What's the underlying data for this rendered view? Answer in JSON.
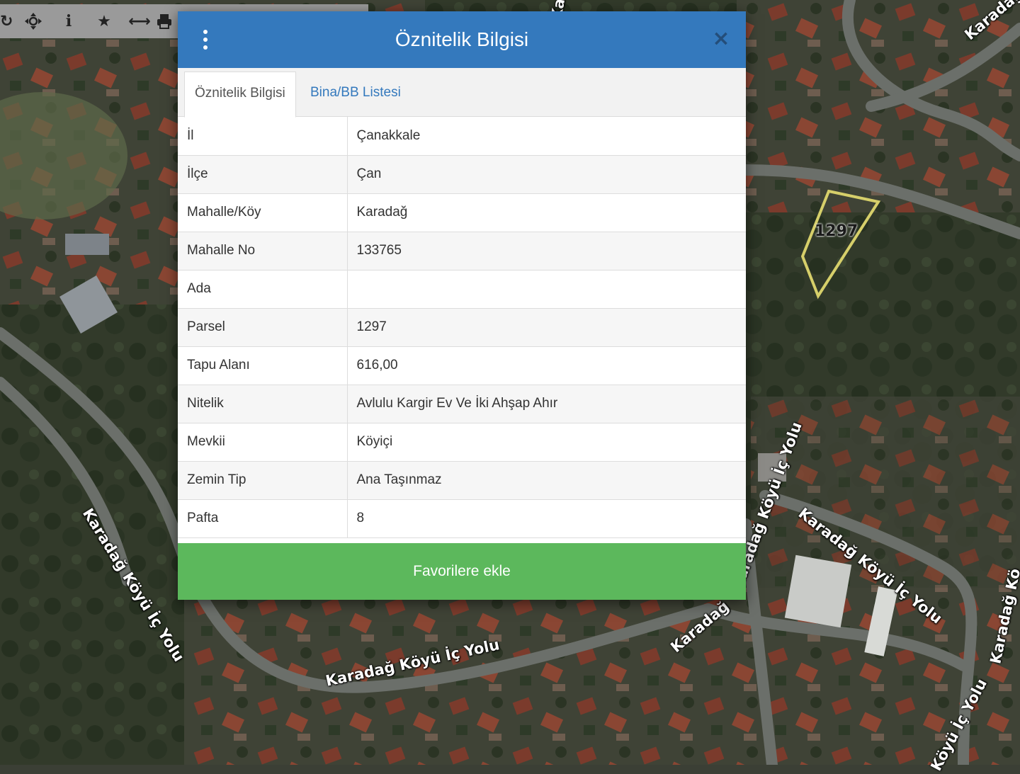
{
  "toolbar": {
    "tools": [
      {
        "icon": "refresh-icon"
      },
      {
        "icon": "pan-move-icon"
      },
      {
        "icon": "info-icon"
      },
      {
        "icon": "star-icon"
      },
      {
        "icon": "measure-distance-icon"
      },
      {
        "icon": "print-icon"
      }
    ]
  },
  "map": {
    "road_labels": [
      "Karadağ Köyü İç Yolu",
      "Karadağ Köyü İç Yolu",
      "Karadağ Köyü İç Yolu",
      "Karadağ",
      "Karadağ Köyü İç Yolu",
      "Köyü İç Yolu",
      "Karadağ Kö",
      "Karadağ",
      "Karad"
    ],
    "parcel_label": "1297",
    "colors": {
      "parcel_outline": "#d6cf6a",
      "road": "#6b6f6a"
    }
  },
  "modal": {
    "title": "Öznitelik Bilgisi",
    "close_symbol": "×",
    "tabs": [
      {
        "label": "Öznitelik Bilgisi",
        "active": true
      },
      {
        "label": "Bina/BB Listesi",
        "active": false
      }
    ],
    "rows": [
      {
        "key": "İl",
        "value": "Çanakkale"
      },
      {
        "key": "İlçe",
        "value": "Çan"
      },
      {
        "key": "Mahalle/Köy",
        "value": "Karadağ"
      },
      {
        "key": "Mahalle No",
        "value": "133765"
      },
      {
        "key": "Ada",
        "value": ""
      },
      {
        "key": "Parsel",
        "value": "1297"
      },
      {
        "key": "Tapu Alanı",
        "value": "616,00"
      },
      {
        "key": "Nitelik",
        "value": "Avlulu Kargir Ev Ve İki Ahşap Ahır"
      },
      {
        "key": "Mevkii",
        "value": "Köyiçi"
      },
      {
        "key": "Zemin Tip",
        "value": "Ana Taşınmaz"
      },
      {
        "key": "Pafta",
        "value": "8"
      }
    ],
    "favorite_button": "Favorilere ekle",
    "colors": {
      "header": "#3479bd",
      "button": "#5cb85c"
    }
  }
}
